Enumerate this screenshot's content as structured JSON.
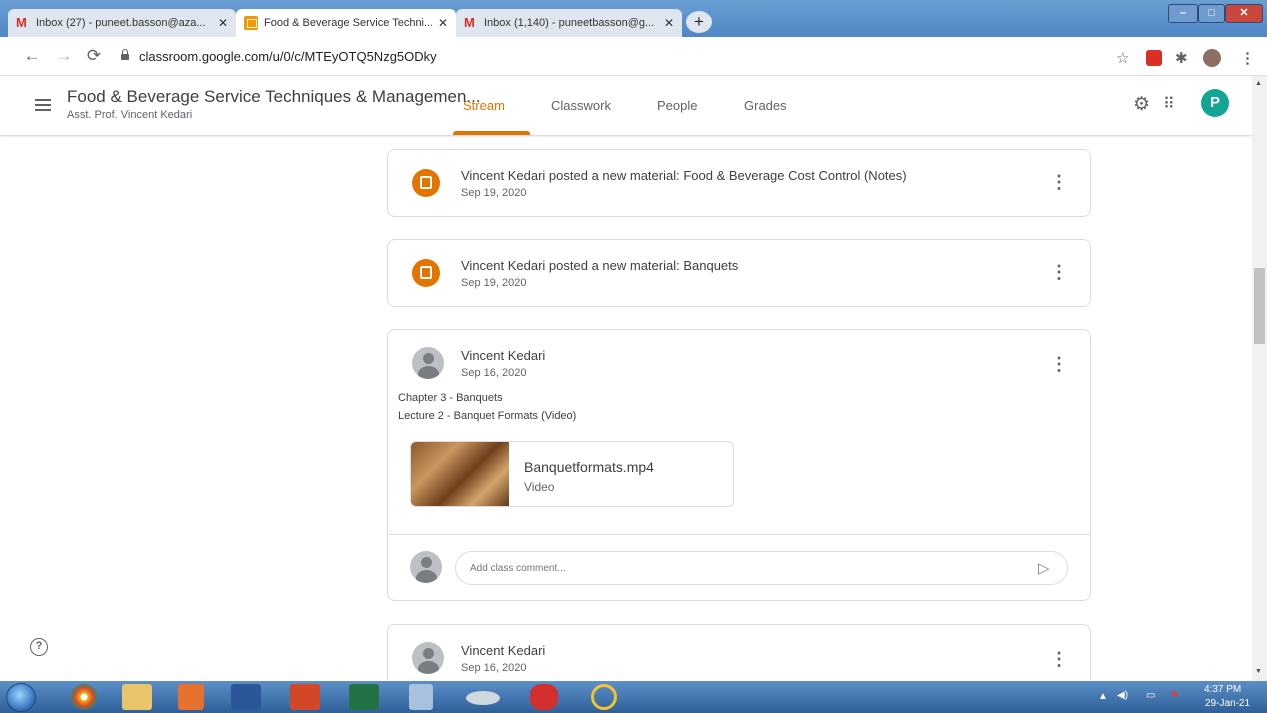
{
  "browser": {
    "tabs": [
      {
        "title": "Inbox (27) - puneet.basson@aza...",
        "icon": "gmail-icon"
      },
      {
        "title": "Food & Beverage Service Techni...",
        "icon": "classroom-icon"
      },
      {
        "title": "Inbox (1,140) - puneetbasson@g...",
        "icon": "gmail-icon"
      }
    ],
    "new_tab": "+",
    "url": "classroom.google.com/u/0/c/MTEyOTQ5Nzg5ODky"
  },
  "header": {
    "course_title": "Food & Beverage Service Techniques & Managemen...",
    "course_subtitle": "Asst. Prof. Vincent Kedari",
    "tabs": [
      "Stream",
      "Classwork",
      "People",
      "Grades"
    ],
    "active_tab": "Stream",
    "avatar_letter": "P"
  },
  "stream": {
    "cards": [
      {
        "title": "Vincent Kedari posted a new material: Food & Beverage Cost Control (Notes)",
        "date": "Sep 19, 2020"
      },
      {
        "title": "Vincent Kedari posted a new material: Banquets",
        "date": "Sep 19, 2020"
      }
    ],
    "post": {
      "author": "Vincent Kedari",
      "date": "Sep 16, 2020",
      "lines": [
        "Chapter 3 - Banquets",
        "Lecture 2 - Banquet Formats (Video)"
      ],
      "attachment": {
        "name": "Banquetformats.mp4",
        "type": "Video"
      },
      "comment_placeholder": "Add class comment..."
    },
    "next_post": {
      "author": "Vincent Kedari",
      "date": "Sep 16, 2020"
    }
  },
  "taskbar": {
    "time": "4:37 PM",
    "date": "29-Jan-21"
  },
  "colors": {
    "accent": "#e37400",
    "avatar": "#12a594"
  }
}
